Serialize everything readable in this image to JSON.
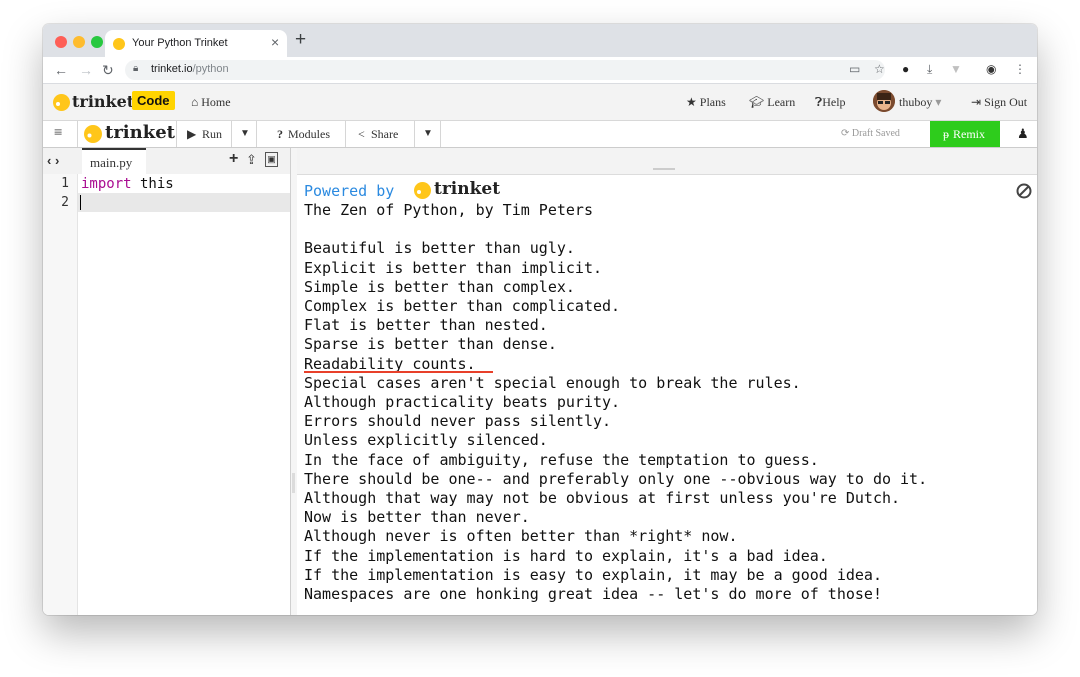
{
  "browser": {
    "tab_title": "Your Python Trinket",
    "tab_close": "×",
    "new_tab": "+",
    "url_host": "trinket.io",
    "url_path": "/python"
  },
  "topnav": {
    "brand": "trinket",
    "badge": "Code",
    "home": "Home",
    "plans": "Plans",
    "learn": "Learn",
    "help": "Help",
    "user": "thuboy",
    "sign_out": "Sign Out"
  },
  "toolbar": {
    "menu_icon": "≡",
    "brand": "trinket",
    "run": "Run",
    "modules": "Modules",
    "share": "Share",
    "draft_status": "Draft Saved",
    "remix": "Remix"
  },
  "editor": {
    "filename": "main.py",
    "line_numbers": [
      "1",
      "2"
    ],
    "code_keyword": "import",
    "code_rest": " this"
  },
  "output": {
    "powered_by": "Powered by",
    "powered_brand": "trinket",
    "lines": [
      "The Zen of Python, by Tim Peters",
      "",
      "Beautiful is better than ugly.",
      "Explicit is better than implicit.",
      "Simple is better than complex.",
      "Complex is better than complicated.",
      "Flat is better than nested.",
      "Sparse is better than dense.",
      "Readability counts.",
      "Special cases aren't special enough to break the rules.",
      "Although practicality beats purity.",
      "Errors should never pass silently.",
      "Unless explicitly silenced.",
      "In the face of ambiguity, refuse the temptation to guess.",
      "There should be one-- and preferably only one --obvious way to do it.",
      "Although that way may not be obvious at first unless you're Dutch.",
      "Now is better than never.",
      "Although never is often better than *right* now.",
      "If the implementation is hard to explain, it's a bad idea.",
      "If the implementation is easy to explain, it may be a good idea.",
      "Namespaces are one honking great idea -- let's do more of those!"
    ]
  },
  "colors": {
    "remix_green": "#2ecc1c",
    "badge_yellow": "#ffd400",
    "powered_blue": "#2b8ae0",
    "keyword_purple": "#aa0d91"
  }
}
